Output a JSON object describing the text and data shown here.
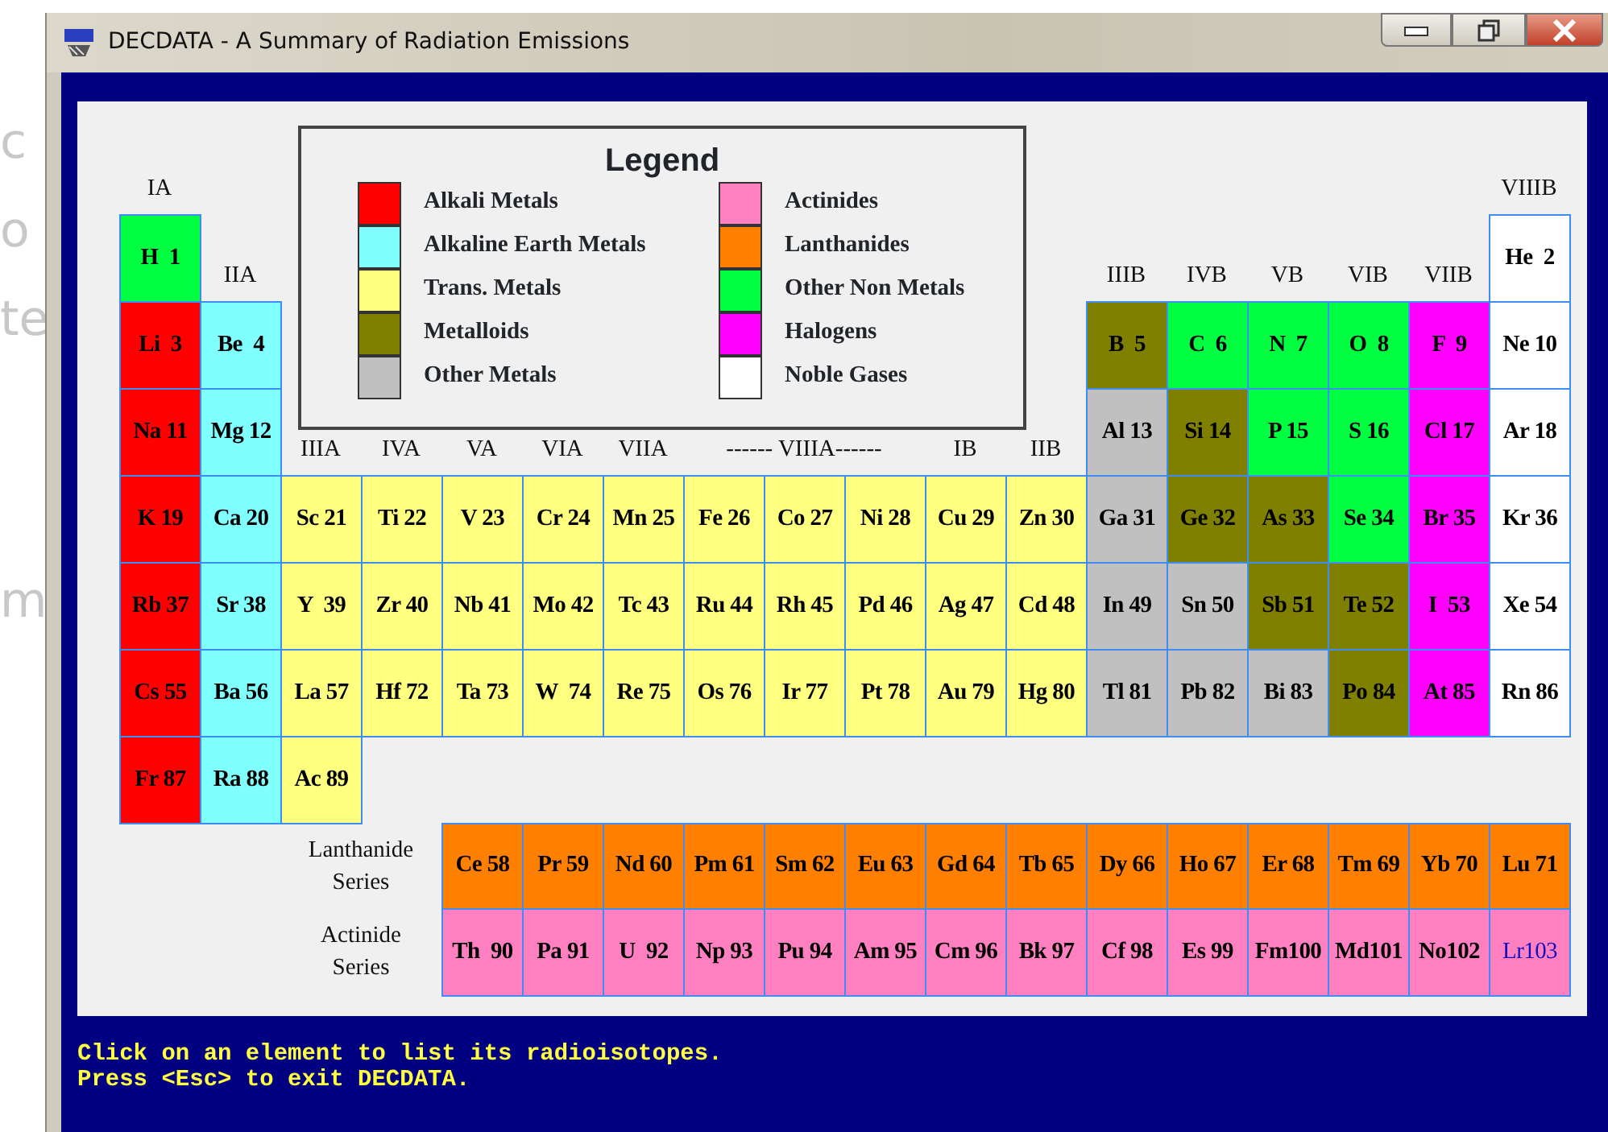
{
  "background_fragments": [
    "c",
    "o",
    "te",
    "m"
  ],
  "window": {
    "title": "DECDATA - A Summary of Radiation Emissions"
  },
  "legend": {
    "title": "Legend",
    "items": [
      {
        "label": "Alkali Metals",
        "color": "#ff0000"
      },
      {
        "label": "Alkaline Earth Metals",
        "color": "#80ffff"
      },
      {
        "label": "Trans. Metals",
        "color": "#ffff80"
      },
      {
        "label": "Metalloids",
        "color": "#808000"
      },
      {
        "label": "Other Metals",
        "color": "#c0c0c0"
      },
      {
        "label": "Actinides",
        "color": "#ff80c0"
      },
      {
        "label": "Lanthanides",
        "color": "#ff8000"
      },
      {
        "label": "Other Non Metals",
        "color": "#00ff40"
      },
      {
        "label": "Halogens",
        "color": "#ff00ff"
      },
      {
        "label": "Noble Gases",
        "color": "#ffffff"
      }
    ]
  },
  "group_headers": [
    {
      "label": "IA"
    },
    {
      "label": "IIA"
    },
    {
      "label": "IIIA"
    },
    {
      "label": "IVA"
    },
    {
      "label": "VA"
    },
    {
      "label": "VIA"
    },
    {
      "label": "VIIA"
    },
    {
      "label": "------ VIIIA------"
    },
    {
      "label": "IB"
    },
    {
      "label": "IIB"
    },
    {
      "label": "IIIB"
    },
    {
      "label": "IVB"
    },
    {
      "label": "VB"
    },
    {
      "label": "VIB"
    },
    {
      "label": "VIIB"
    },
    {
      "label": "VIIIB"
    }
  ],
  "periods": [
    {
      "elements": [
        {
          "label": "H  1",
          "color": "#00ff40",
          "selected": false
        },
        {
          "label": "He  2",
          "color": "#ffffff",
          "selected": false
        }
      ]
    },
    {
      "elements": [
        {
          "label": "Li  3",
          "color": "#ff0000",
          "selected": false
        },
        {
          "label": "Be  4",
          "color": "#80ffff",
          "selected": false
        },
        {
          "label": "B  5",
          "color": "#808000",
          "selected": false
        },
        {
          "label": "C  6",
          "color": "#00ff40",
          "selected": false
        },
        {
          "label": "N  7",
          "color": "#00ff40",
          "selected": false
        },
        {
          "label": "O  8",
          "color": "#00ff40",
          "selected": false
        },
        {
          "label": "F  9",
          "color": "#ff00ff",
          "selected": false
        },
        {
          "label": "Ne 10",
          "color": "#ffffff",
          "selected": false
        }
      ]
    },
    {
      "elements": [
        {
          "label": "Na 11",
          "color": "#ff0000",
          "selected": false
        },
        {
          "label": "Mg 12",
          "color": "#80ffff",
          "selected": false
        },
        {
          "label": "Al 13",
          "color": "#c0c0c0",
          "selected": false
        },
        {
          "label": "Si 14",
          "color": "#808000",
          "selected": false
        },
        {
          "label": "P 15",
          "color": "#00ff40",
          "selected": false
        },
        {
          "label": "S 16",
          "color": "#00ff40",
          "selected": false
        },
        {
          "label": "Cl 17",
          "color": "#ff00ff",
          "selected": false
        },
        {
          "label": "Ar 18",
          "color": "#ffffff",
          "selected": false
        }
      ]
    },
    {
      "elements": [
        {
          "label": "K 19",
          "color": "#ff0000",
          "selected": false
        },
        {
          "label": "Ca 20",
          "color": "#80ffff",
          "selected": false
        },
        {
          "label": "Sc 21",
          "color": "#ffff80",
          "selected": false
        },
        {
          "label": "Ti 22",
          "color": "#ffff80",
          "selected": false
        },
        {
          "label": "V 23",
          "color": "#ffff80",
          "selected": false
        },
        {
          "label": "Cr 24",
          "color": "#ffff80",
          "selected": false
        },
        {
          "label": "Mn 25",
          "color": "#ffff80",
          "selected": false
        },
        {
          "label": "Fe 26",
          "color": "#ffff80",
          "selected": false
        },
        {
          "label": "Co 27",
          "color": "#ffff80",
          "selected": false
        },
        {
          "label": "Ni 28",
          "color": "#ffff80",
          "selected": false
        },
        {
          "label": "Cu 29",
          "color": "#ffff80",
          "selected": false
        },
        {
          "label": "Zn 30",
          "color": "#ffff80",
          "selected": false
        },
        {
          "label": "Ga 31",
          "color": "#c0c0c0",
          "selected": false
        },
        {
          "label": "Ge 32",
          "color": "#808000",
          "selected": false
        },
        {
          "label": "As 33",
          "color": "#808000",
          "selected": false
        },
        {
          "label": "Se 34",
          "color": "#00ff40",
          "selected": false
        },
        {
          "label": "Br 35",
          "color": "#ff00ff",
          "selected": false
        },
        {
          "label": "Kr 36",
          "color": "#ffffff",
          "selected": false
        }
      ]
    },
    {
      "elements": [
        {
          "label": "Rb 37",
          "color": "#ff0000",
          "selected": false
        },
        {
          "label": "Sr 38",
          "color": "#80ffff",
          "selected": false
        },
        {
          "label": "Y  39",
          "color": "#ffff80",
          "selected": false
        },
        {
          "label": "Zr 40",
          "color": "#ffff80",
          "selected": false
        },
        {
          "label": "Nb 41",
          "color": "#ffff80",
          "selected": false
        },
        {
          "label": "Mo 42",
          "color": "#ffff80",
          "selected": false
        },
        {
          "label": "Tc 43",
          "color": "#ffff80",
          "selected": false
        },
        {
          "label": "Ru 44",
          "color": "#ffff80",
          "selected": false
        },
        {
          "label": "Rh 45",
          "color": "#ffff80",
          "selected": false
        },
        {
          "label": "Pd 46",
          "color": "#ffff80",
          "selected": false
        },
        {
          "label": "Ag 47",
          "color": "#ffff80",
          "selected": false
        },
        {
          "label": "Cd 48",
          "color": "#ffff80",
          "selected": false
        },
        {
          "label": "In 49",
          "color": "#c0c0c0",
          "selected": false
        },
        {
          "label": "Sn 50",
          "color": "#c0c0c0",
          "selected": false
        },
        {
          "label": "Sb 51",
          "color": "#808000",
          "selected": false
        },
        {
          "label": "Te 52",
          "color": "#808000",
          "selected": false
        },
        {
          "label": "I  53",
          "color": "#ff00ff",
          "selected": false
        },
        {
          "label": "Xe 54",
          "color": "#ffffff",
          "selected": false
        }
      ]
    },
    {
      "elements": [
        {
          "label": "Cs 55",
          "color": "#ff0000",
          "selected": false
        },
        {
          "label": "Ba 56",
          "color": "#80ffff",
          "selected": false
        },
        {
          "label": "La 57",
          "color": "#ffff80",
          "selected": false
        },
        {
          "label": "Hf 72",
          "color": "#ffff80",
          "selected": false
        },
        {
          "label": "Ta 73",
          "color": "#ffff80",
          "selected": false
        },
        {
          "label": "W  74",
          "color": "#ffff80",
          "selected": false
        },
        {
          "label": "Re 75",
          "color": "#ffff80",
          "selected": false
        },
        {
          "label": "Os 76",
          "color": "#ffff80",
          "selected": false
        },
        {
          "label": "Ir 77",
          "color": "#ffff80",
          "selected": false
        },
        {
          "label": "Pt 78",
          "color": "#ffff80",
          "selected": false
        },
        {
          "label": "Au 79",
          "color": "#ffff80",
          "selected": false
        },
        {
          "label": "Hg 80",
          "color": "#ffff80",
          "selected": false
        },
        {
          "label": "Tl 81",
          "color": "#c0c0c0",
          "selected": false
        },
        {
          "label": "Pb 82",
          "color": "#c0c0c0",
          "selected": false
        },
        {
          "label": "Bi 83",
          "color": "#c0c0c0",
          "selected": false
        },
        {
          "label": "Po 84",
          "color": "#808000",
          "selected": false
        },
        {
          "label": "At 85",
          "color": "#ff00ff",
          "selected": false
        },
        {
          "label": "Rn 86",
          "color": "#ffffff",
          "selected": false
        }
      ]
    },
    {
      "elements": [
        {
          "label": "Fr 87",
          "color": "#ff0000",
          "selected": false
        },
        {
          "label": "Ra 88",
          "color": "#80ffff",
          "selected": false
        },
        {
          "label": "Ac 89",
          "color": "#ffff80",
          "selected": false
        }
      ]
    }
  ],
  "series": [
    {
      "label": "Lanthanide Series",
      "elements": [
        {
          "label": "Ce 58",
          "color": "#ff8000",
          "selected": false
        },
        {
          "label": "Pr 59",
          "color": "#ff8000",
          "selected": false
        },
        {
          "label": "Nd 60",
          "color": "#ff8000",
          "selected": false
        },
        {
          "label": "Pm 61",
          "color": "#ff8000",
          "selected": false
        },
        {
          "label": "Sm 62",
          "color": "#ff8000",
          "selected": false
        },
        {
          "label": "Eu 63",
          "color": "#ff8000",
          "selected": false
        },
        {
          "label": "Gd 64",
          "color": "#ff8000",
          "selected": false
        },
        {
          "label": "Tb 65",
          "color": "#ff8000",
          "selected": false
        },
        {
          "label": "Dy 66",
          "color": "#ff8000",
          "selected": false
        },
        {
          "label": "Ho 67",
          "color": "#ff8000",
          "selected": false
        },
        {
          "label": "Er 68",
          "color": "#ff8000",
          "selected": false
        },
        {
          "label": "Tm 69",
          "color": "#ff8000",
          "selected": false
        },
        {
          "label": "Yb 70",
          "color": "#ff8000",
          "selected": false
        },
        {
          "label": "Lu 71",
          "color": "#ff8000",
          "selected": false
        }
      ]
    },
    {
      "label": "Actinide Series",
      "elements": [
        {
          "label": "Th  90",
          "color": "#ff80c0",
          "selected": false
        },
        {
          "label": "Pa 91",
          "color": "#ff80c0",
          "selected": false
        },
        {
          "label": "U  92",
          "color": "#ff80c0",
          "selected": false
        },
        {
          "label": "Np 93",
          "color": "#ff80c0",
          "selected": false
        },
        {
          "label": "Pu 94",
          "color": "#ff80c0",
          "selected": false
        },
        {
          "label": "Am 95",
          "color": "#ff80c0",
          "selected": false
        },
        {
          "label": "Cm 96",
          "color": "#ff80c0",
          "selected": false
        },
        {
          "label": "Bk 97",
          "color": "#ff80c0",
          "selected": false
        },
        {
          "label": "Cf 98",
          "color": "#ff80c0",
          "selected": false
        },
        {
          "label": "Es 99",
          "color": "#ff80c0",
          "selected": false
        },
        {
          "label": "Fm100",
          "color": "#ff80c0",
          "selected": false
        },
        {
          "label": "Md101",
          "color": "#ff80c0",
          "selected": false
        },
        {
          "label": "No102",
          "color": "#ff80c0",
          "selected": false
        },
        {
          "label": "Lr103",
          "color": "#ff80c0",
          "selected": true
        }
      ]
    }
  ],
  "messages": [
    "Click on an element to list its radioisotopes.",
    "Press <Esc> to exit DECDATA."
  ]
}
